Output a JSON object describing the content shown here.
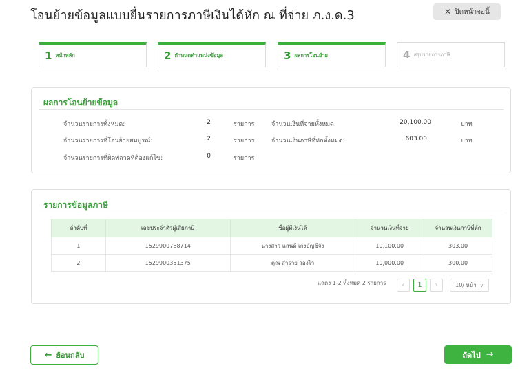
{
  "page": {
    "title": "โอนย้ายข้อมูลแบบยื่นรายการภาษีเงินได้หัก ณ ที่จ่าย ภ.ง.ด.3"
  },
  "close_button": {
    "icon": "close-icon",
    "label": "ปิดหน้าจอนี้"
  },
  "steps": [
    {
      "num": "1",
      "label": "หน้าหลัก",
      "state": "done"
    },
    {
      "num": "2",
      "label": "กำหนดตำแหน่งข้อมูล",
      "state": "done"
    },
    {
      "num": "3",
      "label": "ผลการโอนย้าย",
      "state": "current"
    },
    {
      "num": "4",
      "label": "สรุปรายการภาษี",
      "state": "pending"
    }
  ],
  "summary": {
    "title": "ผลการโอนย้ายข้อมูล",
    "left": [
      {
        "label": "จำนวนรายการทั้งหมด:",
        "value": "2",
        "unit": "รายการ"
      },
      {
        "label": "จำนวนรายการที่โอนย้ายสมบูรณ์:",
        "value": "2",
        "unit": "รายการ"
      },
      {
        "label": "จำนวนรายการที่ผิดพลาดที่ต้องแก้ไข:",
        "value": "0",
        "unit": "รายการ"
      }
    ],
    "right": [
      {
        "label": "จำนวนเงินที่จ่ายทั้งหมด:",
        "value": "20,100.00",
        "unit": "บาท"
      },
      {
        "label": "จำนวนเงินภาษีที่หักทั้งหมด:",
        "value": "603.00",
        "unit": "บาท"
      }
    ]
  },
  "tax_list": {
    "title": "รายการข้อมูลภาษี",
    "columns": [
      "ลำดับที่",
      "เลขประจำตัวผู้เสียภาษี",
      "ชื่อผู้มีเงินได้",
      "จำนวนเงินที่จ่าย",
      "จำนวนเงินภาษีที่หัก"
    ],
    "rows": [
      [
        "1",
        "1529900788714",
        "นางสาว แสนดี เก่งบัญชีจัง",
        "10,100.00",
        "303.00"
      ],
      [
        "2",
        "1529900351375",
        "คุณ สำรวย ว่องไว",
        "10,000.00",
        "300.00"
      ]
    ],
    "pagination": {
      "summary": "แสดง 1-2 ทั้งหมด 2 รายการ",
      "current_page": "1",
      "page_size": "10/ หน้า",
      "prev_icon": "chevron-left-icon",
      "next_icon": "chevron-right-icon"
    }
  },
  "footer": {
    "back_label": "ย้อนกลับ",
    "back_icon": "arrow-left-icon",
    "next_label": "ถัดไป",
    "next_icon": "arrow-right-icon"
  },
  "colors": {
    "accent": "#3fb33f",
    "header_bg": "#e3f5e3"
  }
}
